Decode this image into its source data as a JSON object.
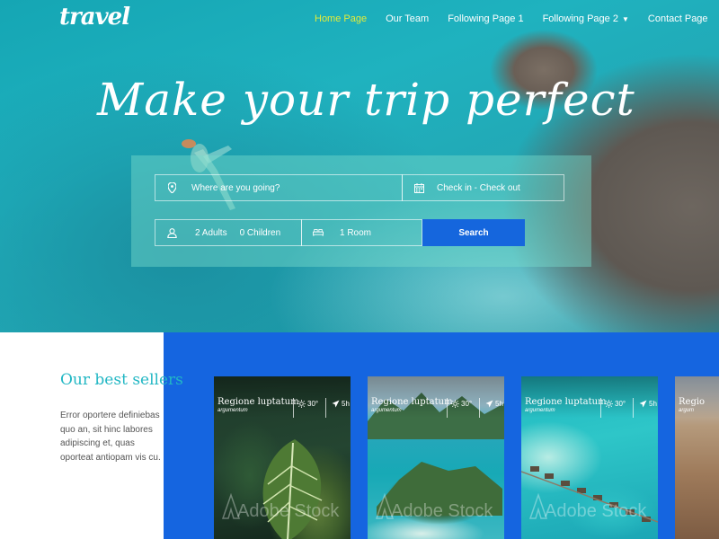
{
  "brand": {
    "logo": "travel"
  },
  "nav": {
    "items": [
      {
        "label": "Home Page",
        "active": true
      },
      {
        "label": "Our Team",
        "active": false
      },
      {
        "label": "Following Page 1",
        "active": false
      },
      {
        "label": "Following Page 2",
        "active": false,
        "dropdown": true
      },
      {
        "label": "Contact Page",
        "active": false
      }
    ]
  },
  "hero": {
    "headline": "Make your trip perfect"
  },
  "search": {
    "where_placeholder": "Where are you going?",
    "dates_label": "Check in - Check out",
    "adults_label": "2 Adults",
    "children_label": "0 Children",
    "rooms_label": "1 Room",
    "button_label": "Search"
  },
  "best_sellers": {
    "title": "Our best sellers",
    "description": "Error oportere definiebas quo an, sit hinc labores adipiscing et, quas oporteat antiopam vis cu."
  },
  "cards": [
    {
      "title": "Regione luptatum",
      "subtitle": "argumentum",
      "temp": "30°",
      "duration": "5h",
      "watermark": "Adobe Stock"
    },
    {
      "title": "Regione luptatum",
      "subtitle": "argumentum",
      "temp": "30°",
      "duration": "5h",
      "watermark": "Adobe Stock"
    },
    {
      "title": "Regione luptatum",
      "subtitle": "argumentum",
      "temp": "30°",
      "duration": "5h",
      "watermark": "Adobe Stock"
    },
    {
      "title": "Regio",
      "subtitle": "argum"
    }
  ],
  "colors": {
    "accent_blue": "#1565e0",
    "active_nav": "#e2ec3a",
    "best_title": "#22b7c4"
  }
}
